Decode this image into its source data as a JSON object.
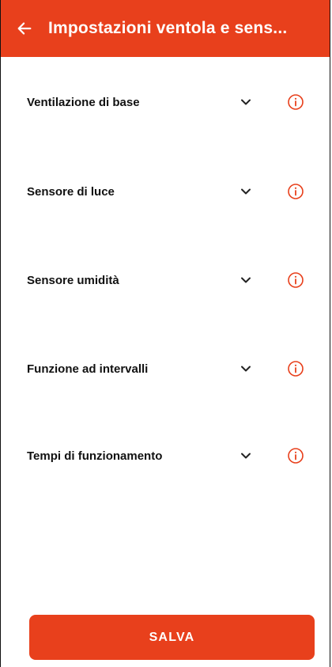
{
  "header": {
    "title": "Impostazioni ventola e sens...",
    "back_icon": "arrow-left-icon",
    "background": "#e8401c"
  },
  "sections": [
    {
      "label": "Ventilazione di base"
    },
    {
      "label": "Sensore di luce"
    },
    {
      "label": "Sensore umidità"
    },
    {
      "label": "Funzione ad intervalli"
    },
    {
      "label": "Tempi di funzionamento"
    }
  ],
  "icons": {
    "expand": "chevron-down-icon",
    "info": "info-circle-icon"
  },
  "accent": "#e8401c",
  "footer": {
    "save_label": "SALVA"
  }
}
